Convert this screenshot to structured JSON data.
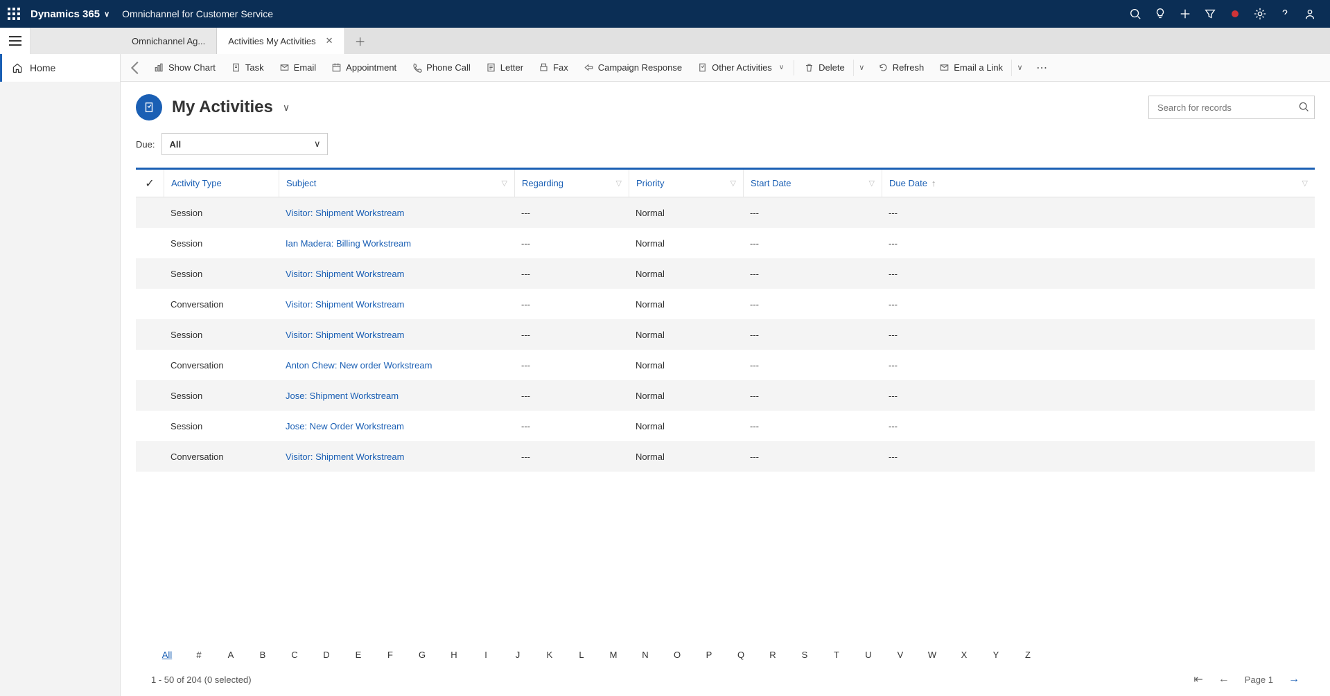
{
  "topbar": {
    "brand": "Dynamics 365",
    "app": "Omnichannel for Customer Service"
  },
  "tabs": {
    "inactive": "Omnichannel Ag...",
    "active": "Activities My Activities"
  },
  "sidebar": {
    "home": "Home"
  },
  "commands": {
    "showChart": "Show Chart",
    "task": "Task",
    "email": "Email",
    "appointment": "Appointment",
    "phoneCall": "Phone Call",
    "letter": "Letter",
    "fax": "Fax",
    "campaignResponse": "Campaign Response",
    "otherActivities": "Other Activities",
    "delete": "Delete",
    "refresh": "Refresh",
    "emailALink": "Email a Link"
  },
  "page": {
    "title": "My Activities",
    "searchPlaceholder": "Search for records",
    "dueLabel": "Due:",
    "dueValue": "All"
  },
  "grid": {
    "columns": {
      "activityType": "Activity Type",
      "subject": "Subject",
      "regarding": "Regarding",
      "priority": "Priority",
      "startDate": "Start Date",
      "dueDate": "Due Date"
    },
    "rows": [
      {
        "type": "Session",
        "subject": "Visitor: Shipment Workstream",
        "regarding": "---",
        "priority": "Normal",
        "start": "---",
        "due": "---"
      },
      {
        "type": "Session",
        "subject": "Ian Madera: Billing Workstream",
        "regarding": "---",
        "priority": "Normal",
        "start": "---",
        "due": "---"
      },
      {
        "type": "Session",
        "subject": "Visitor: Shipment Workstream",
        "regarding": "---",
        "priority": "Normal",
        "start": "---",
        "due": "---"
      },
      {
        "type": "Conversation",
        "subject": "Visitor: Shipment Workstream",
        "regarding": "---",
        "priority": "Normal",
        "start": "---",
        "due": "---"
      },
      {
        "type": "Session",
        "subject": "Visitor: Shipment Workstream",
        "regarding": "---",
        "priority": "Normal",
        "start": "---",
        "due": "---"
      },
      {
        "type": "Conversation",
        "subject": "Anton Chew: New order Workstream",
        "regarding": "---",
        "priority": "Normal",
        "start": "---",
        "due": "---"
      },
      {
        "type": "Session",
        "subject": "Jose: Shipment Workstream",
        "regarding": "---",
        "priority": "Normal",
        "start": "---",
        "due": "---"
      },
      {
        "type": "Session",
        "subject": "Jose: New Order Workstream",
        "regarding": "---",
        "priority": "Normal",
        "start": "---",
        "due": "---"
      },
      {
        "type": "Conversation",
        "subject": "Visitor: Shipment Workstream",
        "regarding": "---",
        "priority": "Normal",
        "start": "---",
        "due": "---"
      }
    ],
    "alpha": [
      "All",
      "#",
      "A",
      "B",
      "C",
      "D",
      "E",
      "F",
      "G",
      "H",
      "I",
      "J",
      "K",
      "L",
      "M",
      "N",
      "O",
      "P",
      "Q",
      "R",
      "S",
      "T",
      "U",
      "V",
      "W",
      "X",
      "Y",
      "Z"
    ],
    "footer": {
      "status": "1 - 50 of 204 (0 selected)",
      "pageLabel": "Page 1"
    }
  }
}
